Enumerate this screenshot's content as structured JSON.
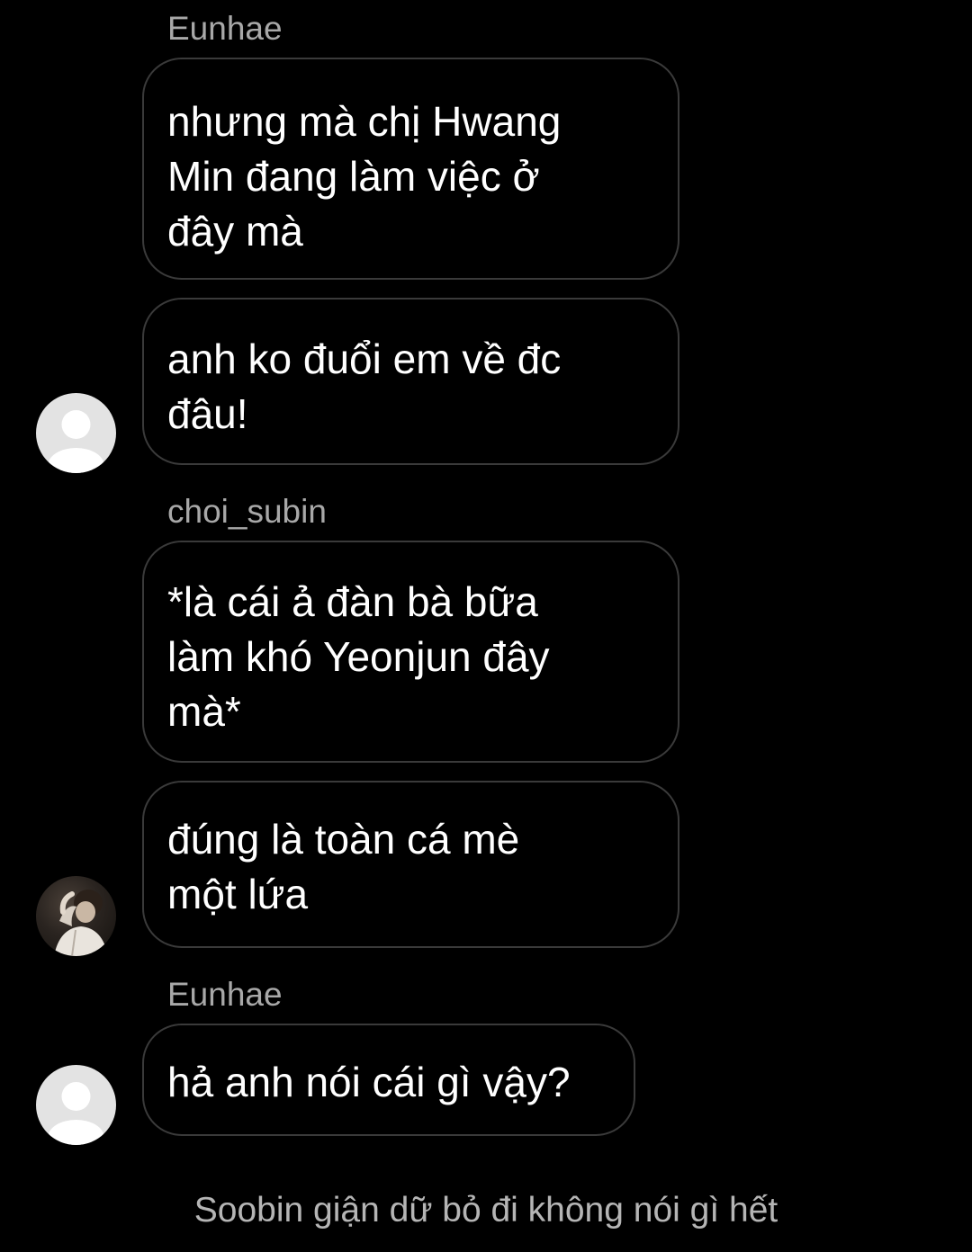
{
  "messages": {
    "sender_1": "Eunhae",
    "bubble_1": {
      "lines": [
        "nhưng mà chị Hwang",
        "Min đang làm việc ở",
        "đây mà"
      ]
    },
    "bubble_2": {
      "lines": [
        "anh ko đuổi em về đc",
        "đâu!"
      ]
    },
    "sender_2": "choi_subin",
    "bubble_3": {
      "lines": [
        "*là cái ả đàn bà bữa",
        "làm khó Yeonjun đây",
        "mà*"
      ]
    },
    "bubble_4": {
      "lines": [
        "đúng là toàn cá mè",
        "một lứa"
      ]
    },
    "sender_3": "Eunhae",
    "bubble_5": {
      "lines": [
        "hả anh nói cái gì vậy?"
      ]
    }
  },
  "narration": "Soobin giận dữ bỏ đi không nói gì hết",
  "avatars": {
    "eunhae_1": "default-user-avatar",
    "choi_subin": "photo-avatar",
    "eunhae_2": "default-user-avatar"
  },
  "colors": {
    "background": "#000000",
    "bubble_border": "#3a3a3a",
    "sender_text": "#a8a8a8",
    "message_text": "#ffffff",
    "narration_text": "#b5b5b5",
    "default_avatar_bg": "#e3e3e3"
  }
}
